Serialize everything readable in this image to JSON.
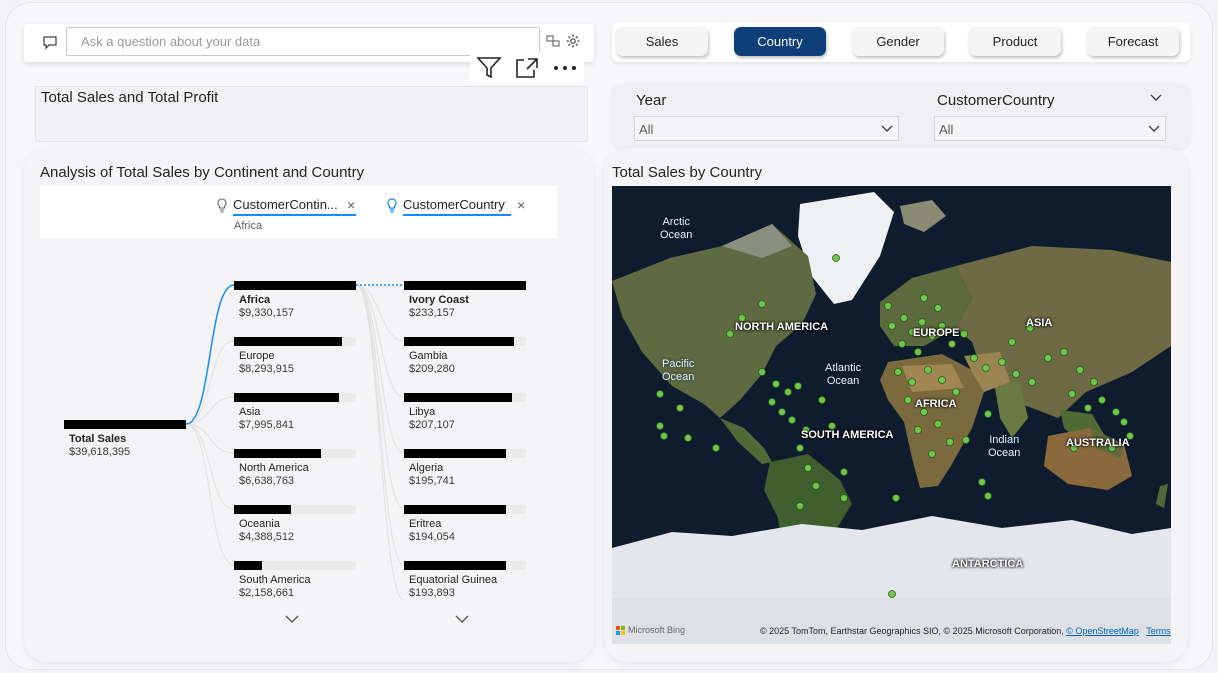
{
  "qa": {
    "placeholder": "Ask a question about your data"
  },
  "visual_header": {
    "icons": [
      "filter-icon",
      "focus-mode-icon",
      "more-options-icon"
    ]
  },
  "cards": {
    "sales_profit_title": "Total Sales and Total Profit"
  },
  "nav": {
    "buttons": [
      "Sales",
      "Country",
      "Gender",
      "Product",
      "Forecast"
    ],
    "active": "Country",
    "active_color": "#0f3f79"
  },
  "slicers": {
    "year": {
      "title": "Year",
      "value": "All"
    },
    "country": {
      "title": "CustomerCountry",
      "value": "All"
    }
  },
  "tree": {
    "title": "Analysis of Total Sales by Continent and Country",
    "filters": [
      {
        "label": "CustomerContin...",
        "sub": "Africa"
      },
      {
        "label": "CustomerCountry"
      }
    ],
    "root": {
      "name": "Total Sales",
      "value": "$39,618,395"
    },
    "continents": [
      {
        "name": "Africa",
        "value": "$9,330,157",
        "fraction": 1.0
      },
      {
        "name": "Europe",
        "value": "$8,293,915",
        "fraction": 0.889
      },
      {
        "name": "Asia",
        "value": "$7,995,841",
        "fraction": 0.857
      },
      {
        "name": "North America",
        "value": "$6,638,763",
        "fraction": 0.712
      },
      {
        "name": "Oceania",
        "value": "$4,388,512",
        "fraction": 0.47
      },
      {
        "name": "South America",
        "value": "$2,158,661",
        "fraction": 0.231
      }
    ],
    "countries": [
      {
        "name": "Ivory Coast",
        "value": "$233,157",
        "fraction": 1.0
      },
      {
        "name": "Gambia",
        "value": "$209,280",
        "fraction": 0.898
      },
      {
        "name": "Libya",
        "value": "$207,107",
        "fraction": 0.888
      },
      {
        "name": "Algeria",
        "value": "$195,741",
        "fraction": 0.84
      },
      {
        "name": "Eritrea",
        "value": "$194,054",
        "fraction": 0.832
      },
      {
        "name": "Equatorial Guinea",
        "value": "$193,893",
        "fraction": 0.832
      }
    ]
  },
  "map": {
    "title": "Total Sales by Country",
    "continent_labels": [
      "NORTH AMERICA",
      "EUROPE",
      "ASIA",
      "AFRICA",
      "SOUTH AMERICA",
      "AUSTRALIA",
      "ANTARCTICA"
    ],
    "ocean_labels": [
      "Arctic Ocean",
      "Pacific Ocean",
      "Atlantic Ocean",
      "Indian Ocean"
    ],
    "attribution_text": "© 2025 TomTom, Earthstar Geographics SIO, © 2025 Microsoft Corporation,",
    "osm_link": "© OpenStreetMap",
    "terms_link": "Terms",
    "brand": "Microsoft Bing",
    "point_color": "#6fc84a"
  }
}
